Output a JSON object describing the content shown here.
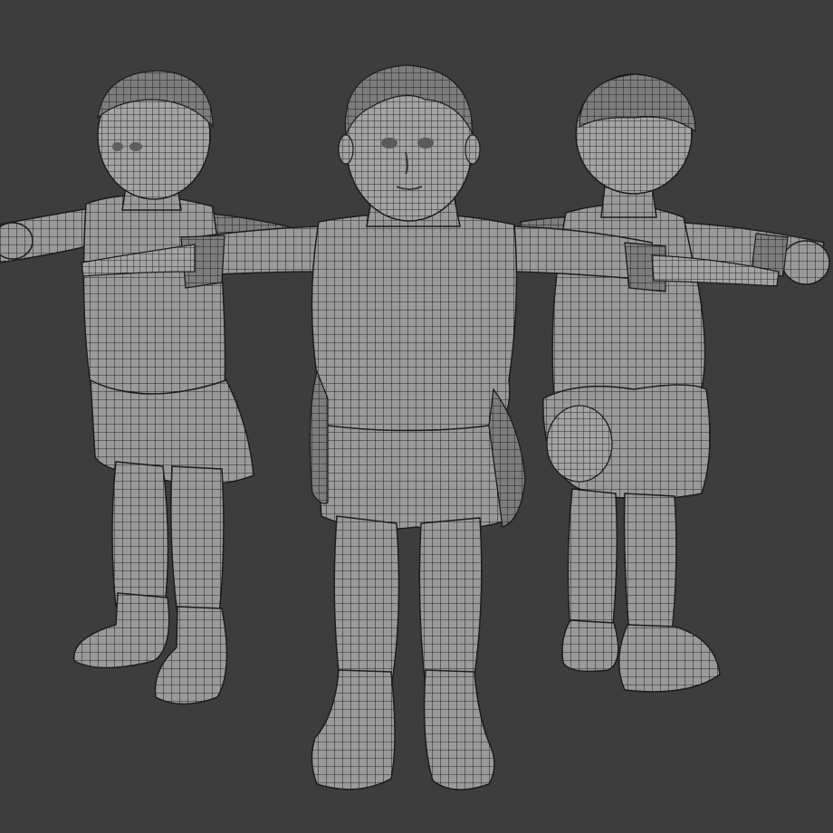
{
  "scene": {
    "background": "#3d3d3d",
    "mesh_fill": "#8f8f8f",
    "mesh_fill_light": "#a9a9a9",
    "wire_color": "#262626",
    "outline_color": "#1c1c1c",
    "figures": [
      {
        "name": "three-quarter-view-figure"
      },
      {
        "name": "front-view-figure"
      },
      {
        "name": "back-three-quarter-view-figure"
      }
    ]
  }
}
